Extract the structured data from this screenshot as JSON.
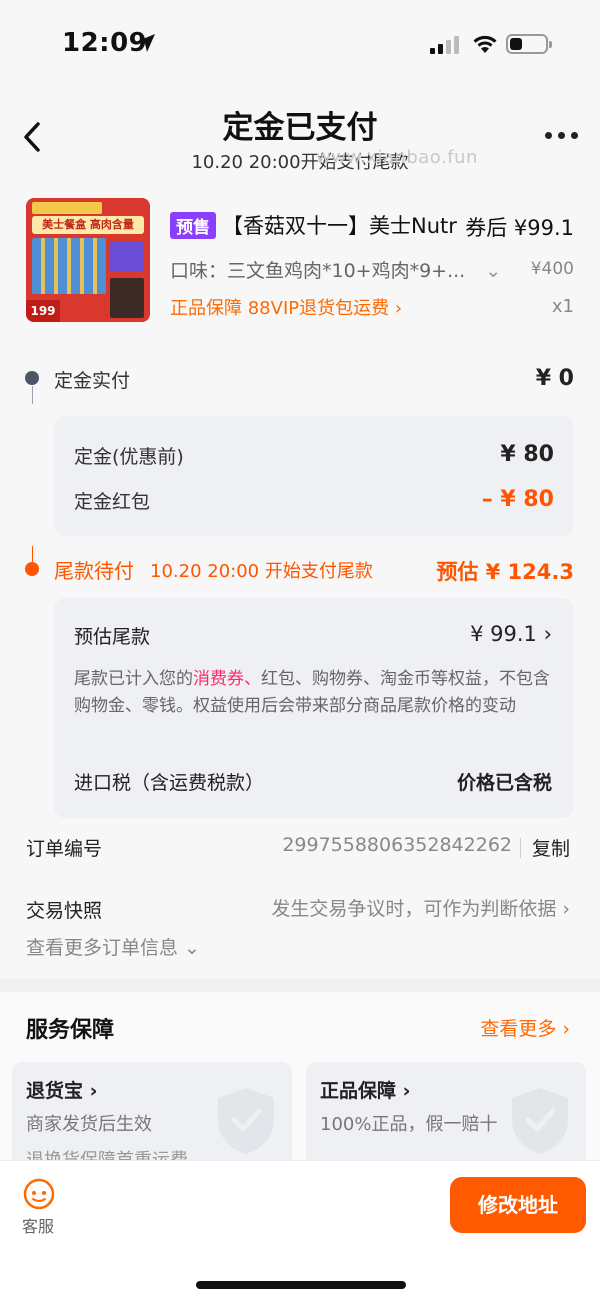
{
  "status_bar": {
    "time": "12:09"
  },
  "header": {
    "title": "定金已支付",
    "subtitle": "10.20 20:00开始支付尾款",
    "watermark": "www.xianbao.fun"
  },
  "product": {
    "thumb_caption": "美士餐盒 高肉含量",
    "thumb_price": "199",
    "badge": "预售",
    "title": "【香菇双十一】美士Nutr",
    "price_label": "券后 ¥99.1",
    "spec": "口味：三文鱼鸡肉*10+鸡肉*9+...",
    "original_price": "¥400",
    "guarantee": "正品保障  88VIP退货包运费 ›",
    "quantity": "x1"
  },
  "deposit": {
    "label": "定金实付",
    "value": "¥ 0",
    "before_discount_label": "定金(优惠前)",
    "before_discount_value": "¥ 80",
    "red_packet_label": "定金红包",
    "red_packet_value": "– ¥ 80"
  },
  "balance": {
    "label": "尾款待付",
    "time": "10.20 20:00 开始支付尾款",
    "estimate": "预估 ¥ 124.3",
    "est_label": "预估尾款",
    "est_value": "¥ 99.1 ›",
    "desc_before": "尾款已计入您的",
    "desc_highlight": "消费券、",
    "desc_after": "红包、购物券、淘金币等权益，不包含购物金、零钱。权益使用后会带来部分商品尾款价格的变动",
    "tax_label": "进口税（含运费税款）",
    "tax_value": "价格已含税"
  },
  "order": {
    "number_label": "订单编号",
    "number": "2997558806352842262",
    "copy": "复制",
    "snapshot_label": "交易快照",
    "snapshot_value": "发生交易争议时，可作为判断依据 ›",
    "more_info": "查看更多订单信息 ⌄"
  },
  "service": {
    "title": "服务保障",
    "more": "查看更多 ›",
    "cards": [
      {
        "title": "退货宝 ›",
        "line1": "商家发货后生效",
        "line2": "退换货保障首重运费"
      },
      {
        "title": "正品保障 ›",
        "line1": "100%正品，假一赔十",
        "line2": ""
      }
    ]
  },
  "bottom": {
    "customer_service": "客服",
    "edit_address": "修改地址"
  }
}
